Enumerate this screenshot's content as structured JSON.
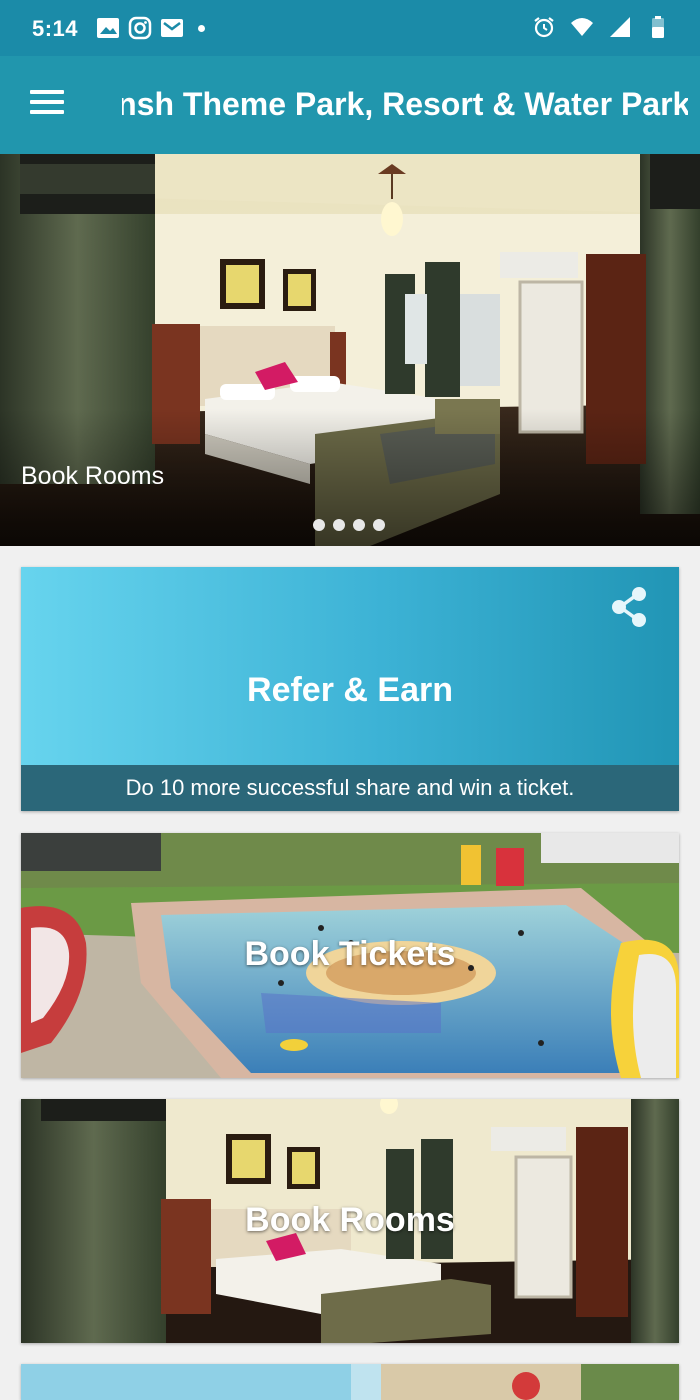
{
  "status_bar": {
    "time": "5:14",
    "left_icons": [
      "gallery-icon",
      "instagram-icon",
      "mail-icon",
      "notification-dot"
    ],
    "right_icons": [
      "alarm-icon",
      "wifi-icon",
      "signal-icon",
      "battery-icon"
    ]
  },
  "app_bar": {
    "title": "Ansh Theme Park, Resort & Water Park",
    "menu_icon": "hamburger-icon",
    "color": "#2196ad"
  },
  "hero_slider": {
    "caption": "Book Rooms",
    "slide_count": 4,
    "active_slide": 1
  },
  "refer_card": {
    "title": "Refer & Earn",
    "subtitle": "Do 10 more successful share and win a ticket.",
    "share_icon": "share-icon"
  },
  "tickets_card": {
    "title": "Book Tickets"
  },
  "rooms_card": {
    "title": "Book Rooms"
  },
  "colors": {
    "status_bar": "#1b8ba8",
    "app_bar": "#2196ad",
    "refer_gradient_start": "#67d4ee",
    "refer_gradient_end": "#2195b5",
    "refer_footer": "#2b6779"
  }
}
